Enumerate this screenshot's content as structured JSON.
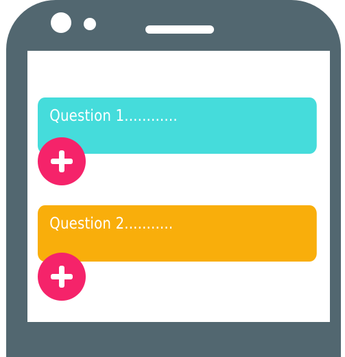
{
  "questions": [
    {
      "label": "Question 1............",
      "color": "#45dcdb"
    },
    {
      "label": "Question 2...........",
      "color": "#f9ae0b"
    }
  ],
  "add_button": {
    "icon": "plus-icon",
    "color": "#f5236a"
  },
  "frame_color": "#526770"
}
